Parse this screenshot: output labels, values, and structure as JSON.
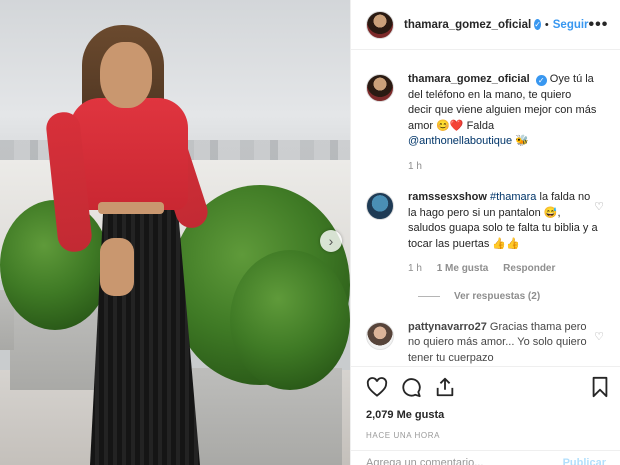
{
  "header": {
    "username": "thamara_gomez_oficial",
    "separator": "•",
    "follow_label": "Seguir",
    "more_label": "•••"
  },
  "caption": {
    "username": "thamara_gomez_oficial",
    "text": "Oye tú la del teléfono en la mano, te quiero decir que viene alguien mejor con más amor 😊❤️ Falda",
    "mention": "@anthonellaboutique",
    "mention_emoji": "🐝",
    "time": "1 h"
  },
  "comments": [
    {
      "username": "ramssesxshow",
      "hashtag": "#thamara",
      "text": " la falda no la hago pero si un pantalon 😅, saludos guapa solo te falta tu biblia y a tocar las puertas 👍👍",
      "time": "1 h",
      "likes": "1 Me gusta",
      "reply": "Responder",
      "view_replies": "Ver respuestas (2)"
    },
    {
      "username": "pattynavarro27",
      "text": " Gracias thama pero no quiero más amor... Yo solo quiero tener tu cuerpazo"
    }
  ],
  "likes_count": "2,079 Me gusta",
  "timestamp": "HACE UNA HORA",
  "add_comment_placeholder": "Agrega un comentario...",
  "post_label": "Publicar",
  "colors": {
    "accent": "#3897f0",
    "link": "#003569"
  },
  "icons": [
    "heart-icon",
    "comment-icon",
    "share-icon",
    "bookmark-icon",
    "verified-badge-icon",
    "chevron-right-icon"
  ]
}
